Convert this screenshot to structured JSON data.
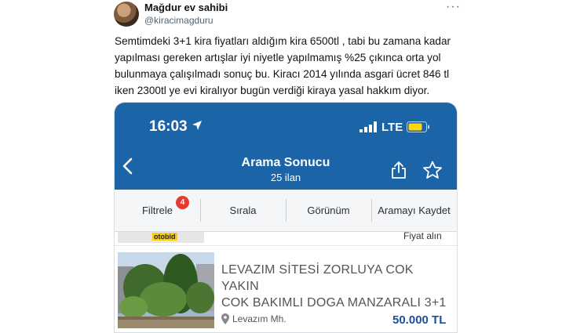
{
  "tweet": {
    "display_name": "Mağdur ev sahibi",
    "handle": "@kiracimagduru",
    "more_label": "···",
    "text_lines": [
      "Semtimdeki 3+1 kira fiyatları aldığım kira 6500tl , tabi bu zamana kadar",
      "yapılması gereken artışlar iyi niyetle yapılmamış %25 çıkınca orta yol",
      "bulunmaya çalışılmadı sonuç bu. Kiracı 2014 yılında asgari ücret 846 tl",
      "iken 2300tl ye evi kiralıyor bugün verdiği kiraya yasal hakkım diyor."
    ]
  },
  "phone": {
    "status": {
      "time": "16:03",
      "network": "LTE"
    },
    "header": {
      "title": "Arama Sonucu",
      "subtitle": "25 ilan"
    },
    "toolbar": {
      "filter_label": "Filtrele",
      "filter_badge": "4",
      "sort_label": "Sırala",
      "view_label": "Görünüm",
      "save_search_label": "Aramayı Kaydet"
    },
    "previous_item": {
      "logo_text": "otobid",
      "note": "Fiyat alın"
    },
    "listing": {
      "title_line1": "LEVAZIM SİTESİ ZORLUYA COK YAKIN",
      "title_line2": "COK BAKIMLI DOGA MANZARALI 3+1",
      "location": "Levazım Mh.",
      "price": "50.000 TL"
    },
    "colors": {
      "header_blue": "#1c64a8",
      "badge_red": "#e8382f",
      "price_blue": "#1c4f9c"
    }
  }
}
